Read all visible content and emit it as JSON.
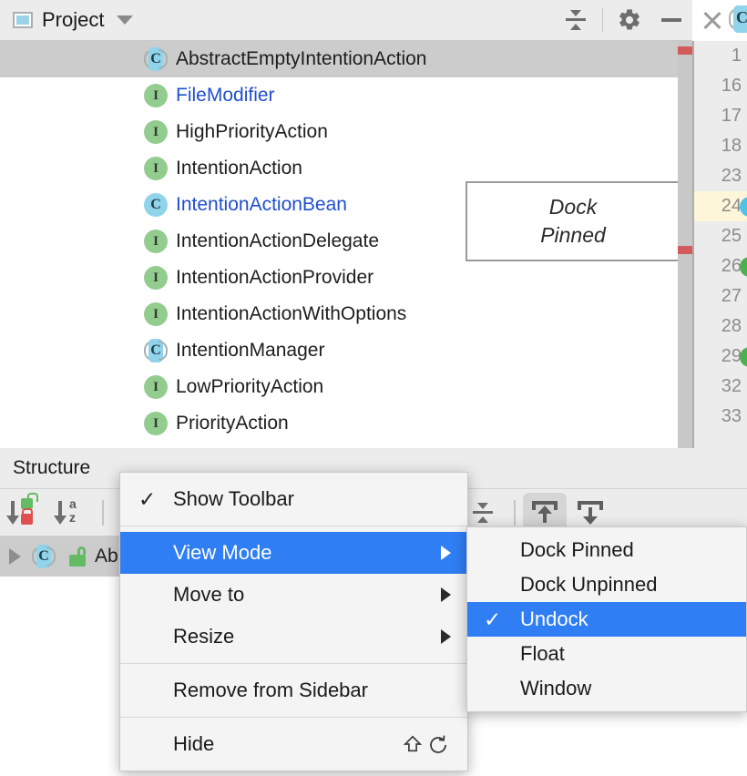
{
  "project_panel": {
    "title": "Project",
    "window_icon": "project-window-icon",
    "dropdown_icon": "chevron-down-icon",
    "toolbar": {
      "collapse_all_icon": "collapse-all-icon",
      "settings_icon": "gear-icon",
      "minimize_icon": "minimize-icon",
      "close_icon": "close-icon"
    },
    "items": [
      {
        "label": "AbstractEmptyIntentionAction",
        "icon": "abstract-class-icon",
        "kind": "abstract-class",
        "selected": true,
        "blue": false
      },
      {
        "label": "FileModifier",
        "icon": "interface-icon",
        "kind": "interface",
        "selected": false,
        "blue": true
      },
      {
        "label": "HighPriorityAction",
        "icon": "interface-icon",
        "kind": "interface",
        "selected": false,
        "blue": false
      },
      {
        "label": "IntentionAction",
        "icon": "interface-icon",
        "kind": "interface",
        "selected": false,
        "blue": false
      },
      {
        "label": "IntentionActionBean",
        "icon": "class-icon",
        "kind": "class",
        "selected": false,
        "blue": true
      },
      {
        "label": "IntentionActionDelegate",
        "icon": "interface-icon",
        "kind": "interface",
        "selected": false,
        "blue": false
      },
      {
        "label": "IntentionActionProvider",
        "icon": "interface-icon",
        "kind": "interface",
        "selected": false,
        "blue": false
      },
      {
        "label": "IntentionActionWithOptions",
        "icon": "interface-icon",
        "kind": "interface",
        "selected": false,
        "blue": false
      },
      {
        "label": "IntentionManager",
        "icon": "abstract-class-icon",
        "kind": "abstract-class",
        "selected": false,
        "blue": false
      },
      {
        "label": "LowPriorityAction",
        "icon": "interface-icon",
        "kind": "interface",
        "selected": false,
        "blue": false
      },
      {
        "label": "PriorityAction",
        "icon": "interface-icon",
        "kind": "interface",
        "selected": false,
        "blue": false
      }
    ]
  },
  "dock_preview": {
    "line1": "Dock",
    "line2": "Pinned"
  },
  "editor_gutter": {
    "lines": [
      {
        "number": "1",
        "highlighted": false,
        "mark": null
      },
      {
        "number": "16",
        "highlighted": false,
        "mark": null
      },
      {
        "number": "17",
        "highlighted": false,
        "mark": null
      },
      {
        "number": "18",
        "highlighted": false,
        "mark": null
      },
      {
        "number": "23",
        "highlighted": false,
        "mark": null
      },
      {
        "number": "24",
        "highlighted": true,
        "mark": "class-icon"
      },
      {
        "number": "25",
        "highlighted": false,
        "mark": null
      },
      {
        "number": "26",
        "highlighted": false,
        "mark": "interface-icon"
      },
      {
        "number": "27",
        "highlighted": false,
        "mark": null
      },
      {
        "number": "28",
        "highlighted": false,
        "mark": null
      },
      {
        "number": "29",
        "highlighted": false,
        "mark": "interface-icon"
      },
      {
        "number": "32",
        "highlighted": false,
        "mark": null
      },
      {
        "number": "33",
        "highlighted": false,
        "mark": null
      }
    ]
  },
  "structure_panel": {
    "title": "Structure",
    "toolbar": {
      "sort_by_visibility_icon": "sort-by-visibility-icon",
      "sort_alphabetically_icon": "sort-alphabetically-icon",
      "sort_az_top": "a",
      "sort_az_bottom": "z",
      "expand_all_icon": "expand-all-icon",
      "collapse_all_icon": "collapse-all-icon",
      "dock_up_icon": "dock-up-icon",
      "dock_down_icon": "dock-down-icon"
    },
    "tree_row": {
      "expander_icon": "expander-triangle-icon",
      "type_icon": "abstract-class-icon",
      "visibility_icon": "public-unlock-icon",
      "label": "Ab"
    }
  },
  "context_menu": {
    "items": [
      {
        "label": "Show Toolbar",
        "checked": true,
        "submenu": false,
        "highlighted": false,
        "shortcut": null
      },
      {
        "label": "View Mode",
        "checked": false,
        "submenu": true,
        "highlighted": true,
        "shortcut": null
      },
      {
        "label": "Move to",
        "checked": false,
        "submenu": true,
        "highlighted": false,
        "shortcut": null
      },
      {
        "label": "Resize",
        "checked": false,
        "submenu": true,
        "highlighted": false,
        "shortcut": null
      },
      {
        "label": "Remove from Sidebar",
        "checked": false,
        "submenu": false,
        "highlighted": false,
        "shortcut": null
      },
      {
        "label": "Hide",
        "checked": false,
        "submenu": false,
        "highlighted": false,
        "shortcut": "shift-undo"
      }
    ],
    "check_glyph": "✓",
    "shortcut_icons": {
      "shift": "shift-key-icon",
      "undo": "undo-arrow-icon"
    }
  },
  "view_mode_submenu": {
    "items": [
      {
        "label": "Dock Pinned",
        "checked": false,
        "highlighted": false
      },
      {
        "label": "Dock Unpinned",
        "checked": false,
        "highlighted": false
      },
      {
        "label": "Undock",
        "checked": true,
        "highlighted": true
      },
      {
        "label": "Float",
        "checked": false,
        "highlighted": false
      },
      {
        "label": "Window",
        "checked": false,
        "highlighted": false
      }
    ],
    "check_glyph": "✓"
  },
  "colors": {
    "panel_bg": "#ececec",
    "selection_gray": "#cccccc",
    "menu_highlight_blue": "#2f7ef4",
    "link_blue": "#1f4fcf",
    "interface_green": "#92cc8e",
    "class_blue": "#90d4ec",
    "marker_red": "#d35b5b",
    "line_highlight": "#fdf6d8"
  }
}
